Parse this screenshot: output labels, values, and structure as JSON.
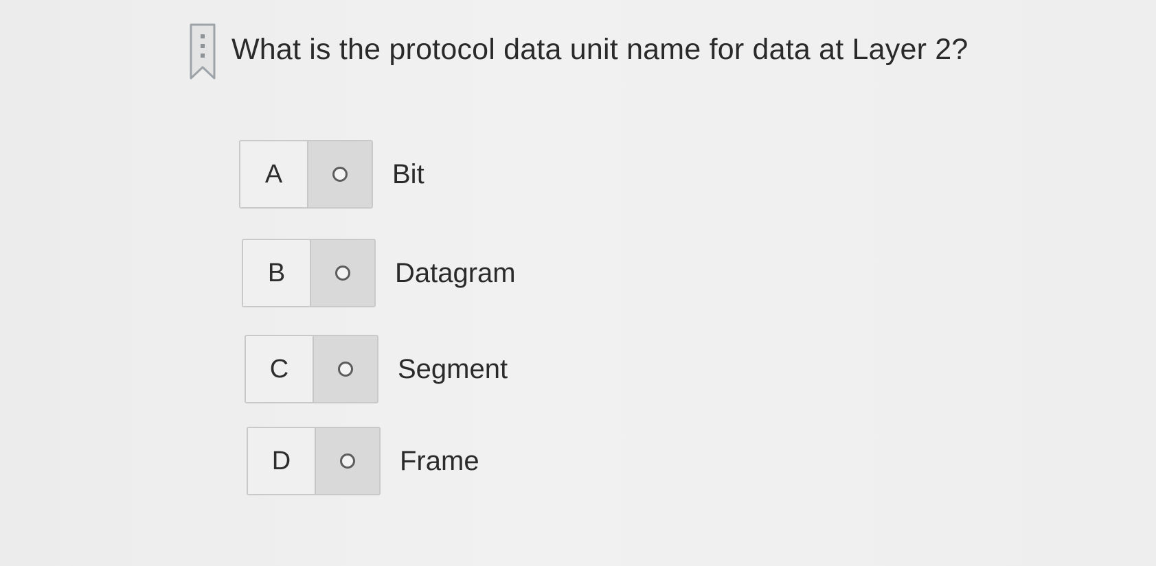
{
  "question": {
    "text": "What is the protocol data unit name for data at Layer 2?",
    "bookmark_icon": "bookmark-icon"
  },
  "options": [
    {
      "letter": "A",
      "label": "Bit",
      "selected": false
    },
    {
      "letter": "B",
      "label": "Datagram",
      "selected": false
    },
    {
      "letter": "C",
      "label": "Segment",
      "selected": false
    },
    {
      "letter": "D",
      "label": "Frame",
      "selected": false
    }
  ],
  "colors": {
    "background": "#efefef",
    "letter_cell": "#f0f0f0",
    "radio_cell": "#d9d9d9",
    "border": "#c9c9c9",
    "text": "#2a2a2a"
  }
}
